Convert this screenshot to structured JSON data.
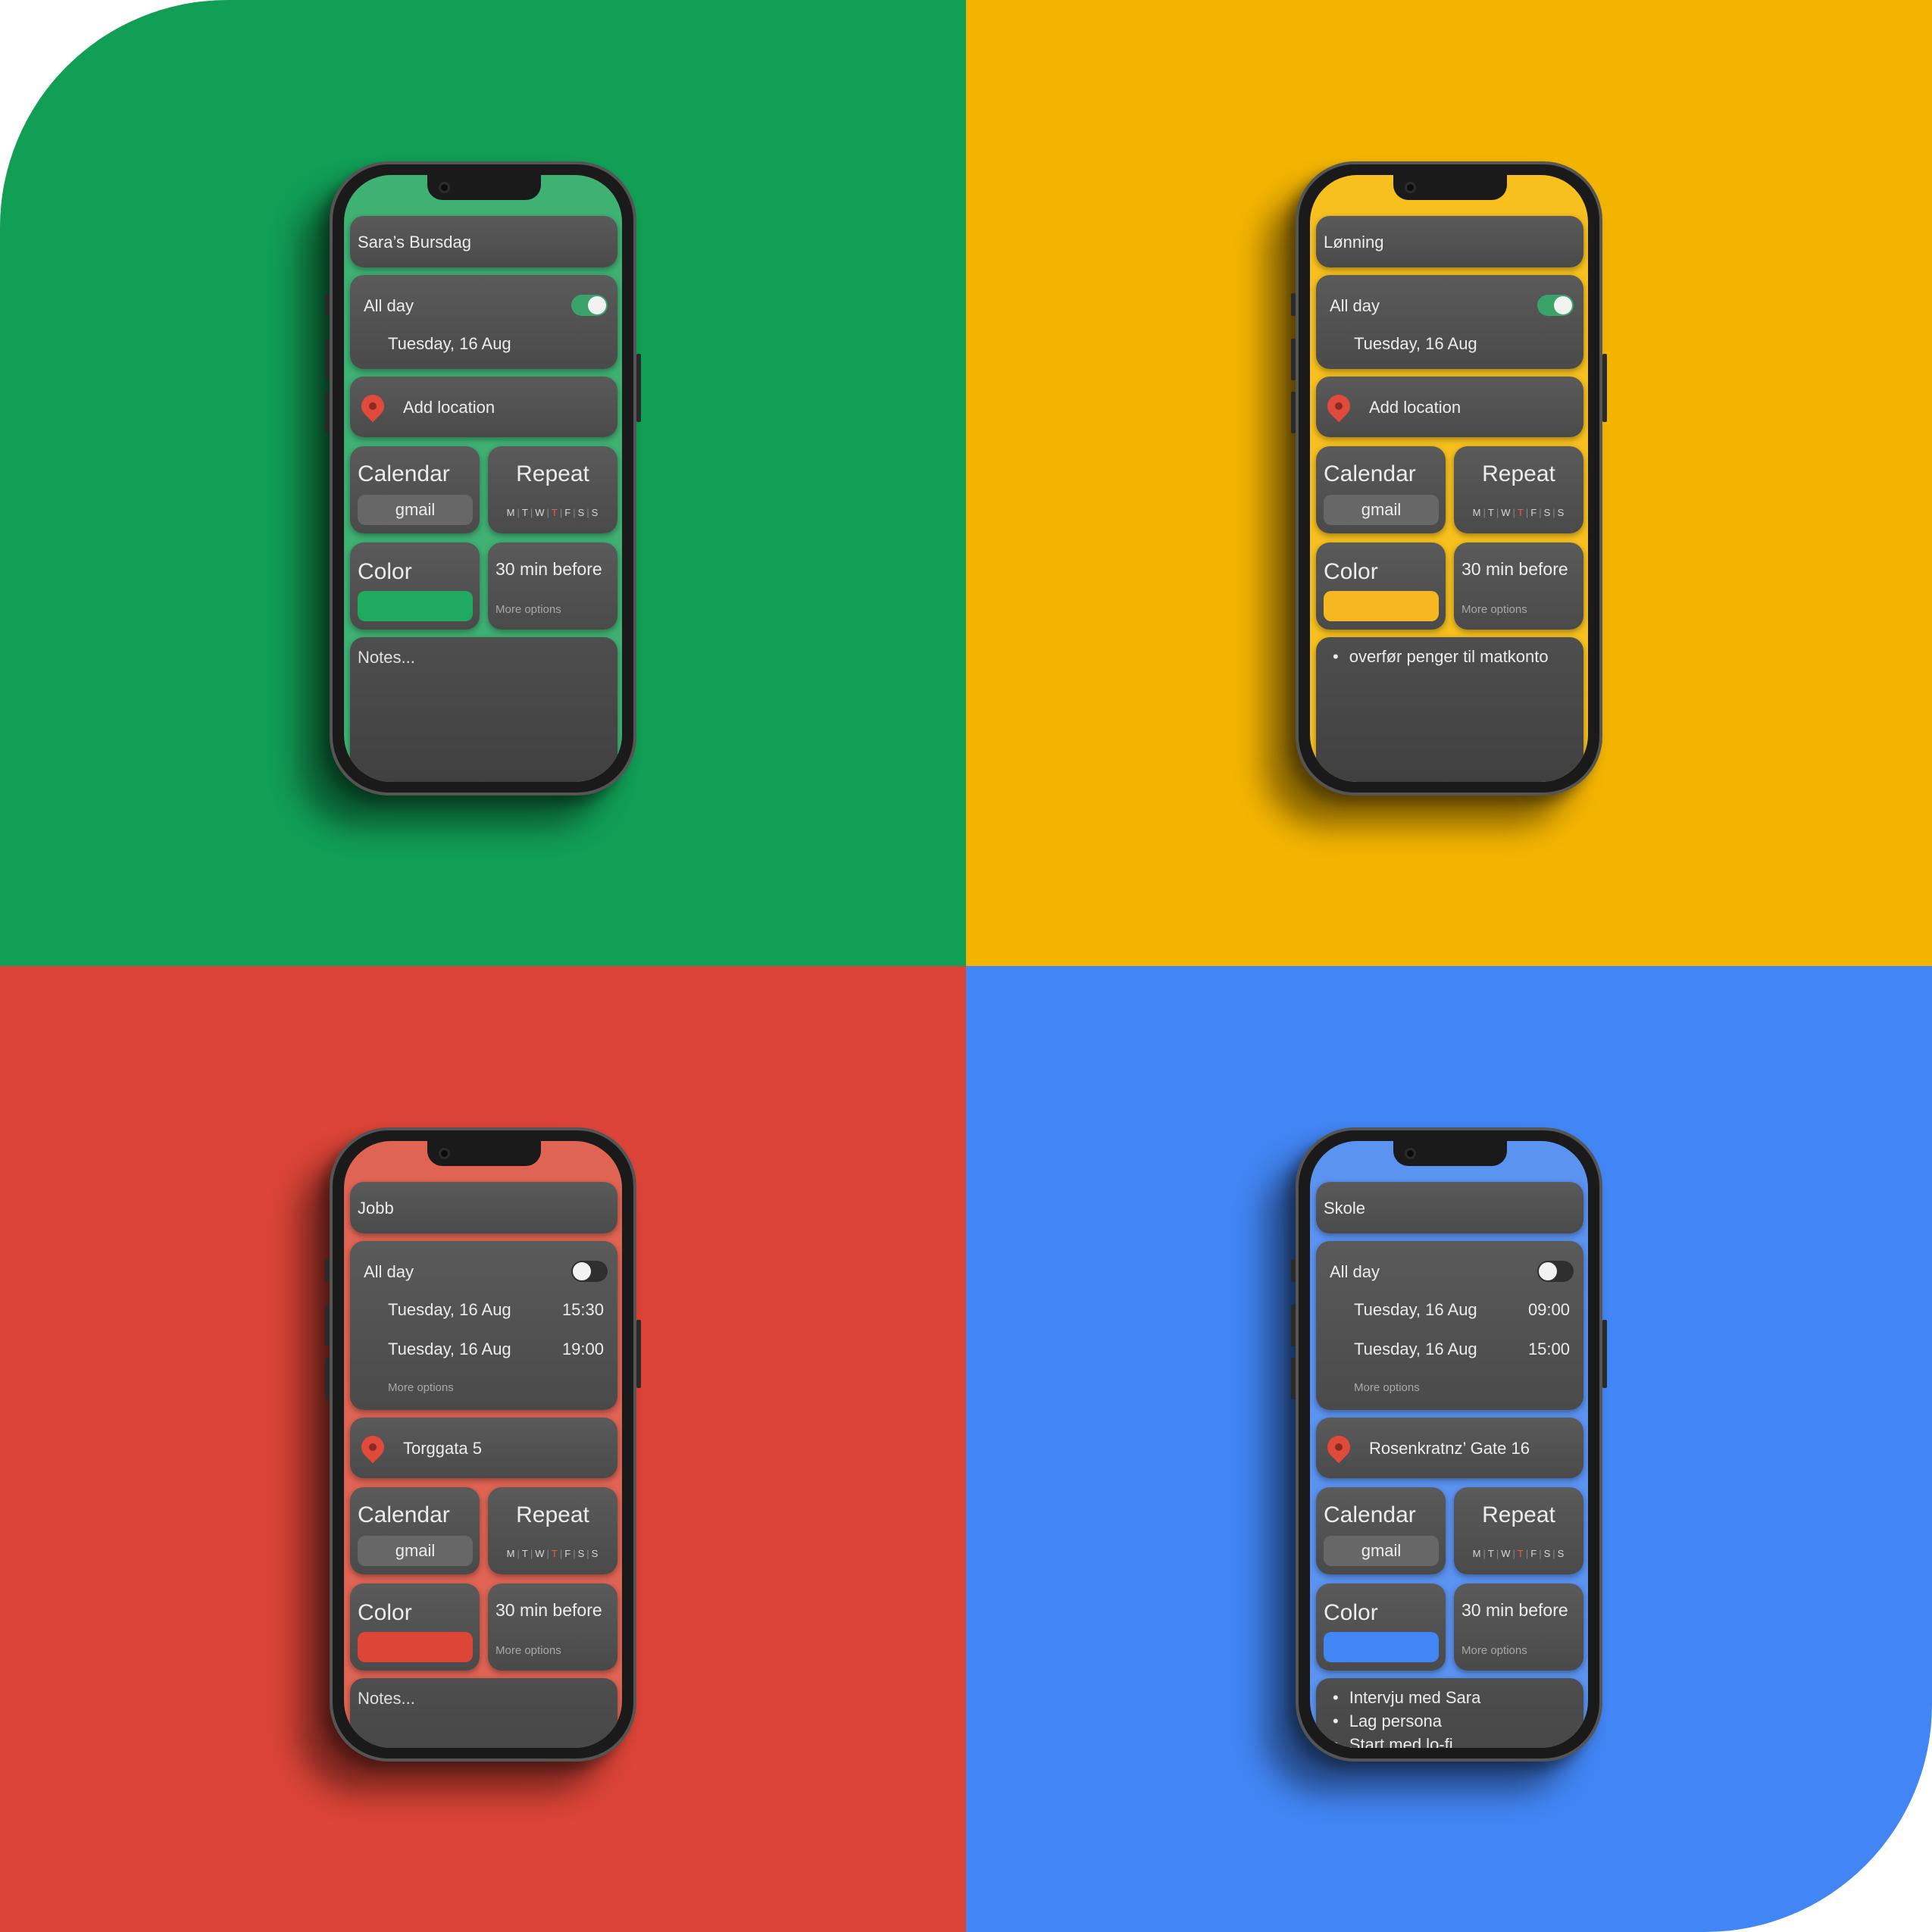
{
  "phones": [
    {
      "background": "#119e55",
      "accent": "#3fb173",
      "title": "Sara’s Bursdag",
      "all_day_label": "All day",
      "all_day_on": true,
      "start_date": "Tuesday, 16 Aug",
      "start_time": "",
      "end_date": "",
      "end_time": "",
      "date_more_options": "",
      "location_icon": "location-pin-icon",
      "location": "Add location",
      "calendar_label": "Calendar",
      "calendar_value": "gmail",
      "repeat_label": "Repeat",
      "repeat_days": [
        "M",
        "T",
        "W",
        "T",
        "F",
        "S",
        "S"
      ],
      "repeat_highlight_index": 3,
      "color_label": "Color",
      "color_value": "#1faa60",
      "reminder": "30 min before",
      "reminder_more": "More options",
      "notes_placeholder": "Notes...",
      "notes_items": []
    },
    {
      "background": "#f3b400",
      "accent": "#f7c01e",
      "title": "Lønning",
      "all_day_label": "All day",
      "all_day_on": true,
      "start_date": "Tuesday, 16 Aug",
      "start_time": "",
      "end_date": "",
      "end_time": "",
      "date_more_options": "",
      "location_icon": "location-pin-icon",
      "location": "Add location",
      "calendar_label": "Calendar",
      "calendar_value": "gmail",
      "repeat_label": "Repeat",
      "repeat_days": [
        "M",
        "T",
        "W",
        "T",
        "F",
        "S",
        "S"
      ],
      "repeat_highlight_index": 3,
      "color_label": "Color",
      "color_value": "#f5b820",
      "reminder": "30 min before",
      "reminder_more": "More options",
      "notes_placeholder": "",
      "notes_items": [
        "overfør penger til matkonto"
      ]
    },
    {
      "background": "#db4437",
      "accent": "#e06454",
      "title": "Jobb",
      "all_day_label": "All day",
      "all_day_on": false,
      "start_date": "Tuesday, 16 Aug",
      "start_time": "15:30",
      "end_date": "Tuesday, 16 Aug",
      "end_time": "19:00",
      "date_more_options": "More options",
      "location_icon": "location-pin-icon",
      "location": "Torggata 5",
      "calendar_label": "Calendar",
      "calendar_value": "gmail",
      "repeat_label": "Repeat",
      "repeat_days": [
        "M",
        "T",
        "W",
        "T",
        "F",
        "S",
        "S"
      ],
      "repeat_highlight_index": 3,
      "color_label": "Color",
      "color_value": "#dd4537",
      "reminder": "30 min before",
      "reminder_more": "More options",
      "notes_placeholder": "Notes...",
      "notes_items": []
    },
    {
      "background": "#4285f4",
      "accent": "#5b93f1",
      "title": "Skole",
      "all_day_label": "All day",
      "all_day_on": false,
      "start_date": "Tuesday, 16 Aug",
      "start_time": "09:00",
      "end_date": "Tuesday, 16 Aug",
      "end_time": "15:00",
      "date_more_options": "More options",
      "location_icon": "location-pin-icon",
      "location": "Rosenkratnz’ Gate 16",
      "calendar_label": "Calendar",
      "calendar_value": "gmail",
      "repeat_label": "Repeat",
      "repeat_days": [
        "M",
        "T",
        "W",
        "T",
        "F",
        "S",
        "S"
      ],
      "repeat_highlight_index": 3,
      "color_label": "Color",
      "color_value": "#4285f4",
      "reminder": "30 min before",
      "reminder_more": "More options",
      "notes_placeholder": "",
      "notes_items": [
        "Intervju med Sara",
        "Lag persona",
        "Start med lo-fi"
      ]
    }
  ]
}
